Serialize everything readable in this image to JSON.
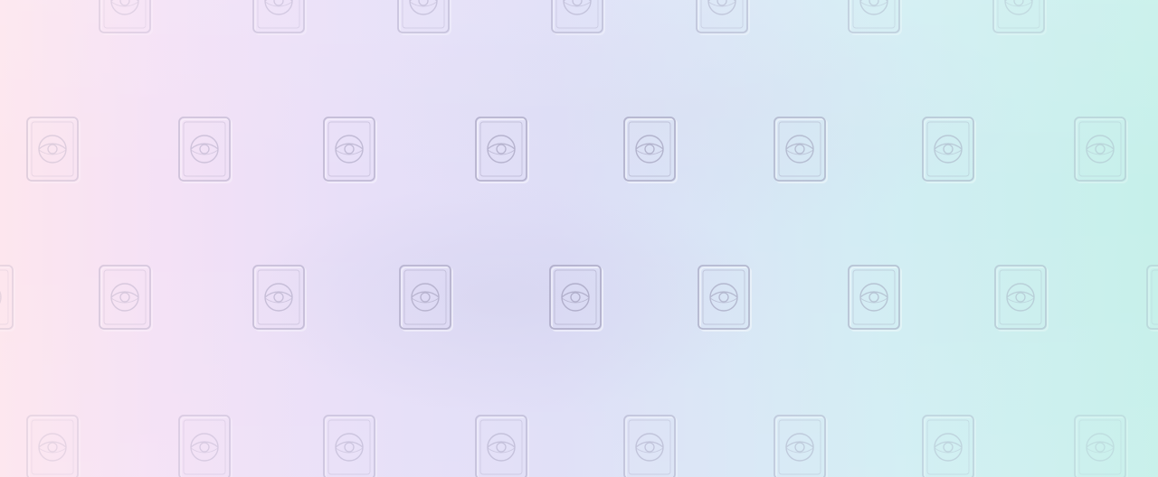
{
  "background": {
    "gradient_colors": [
      "#fde6ee",
      "#f4e1f6",
      "#e8dff8",
      "#dfdef7",
      "#d9e6f6",
      "#d1eef3",
      "#c6f0ea"
    ],
    "emboss_color": "#8e8aa8"
  },
  "pattern": {
    "icon": "card-sleeve-pokeball-icon",
    "rows": 4,
    "visible_cards": 32
  }
}
